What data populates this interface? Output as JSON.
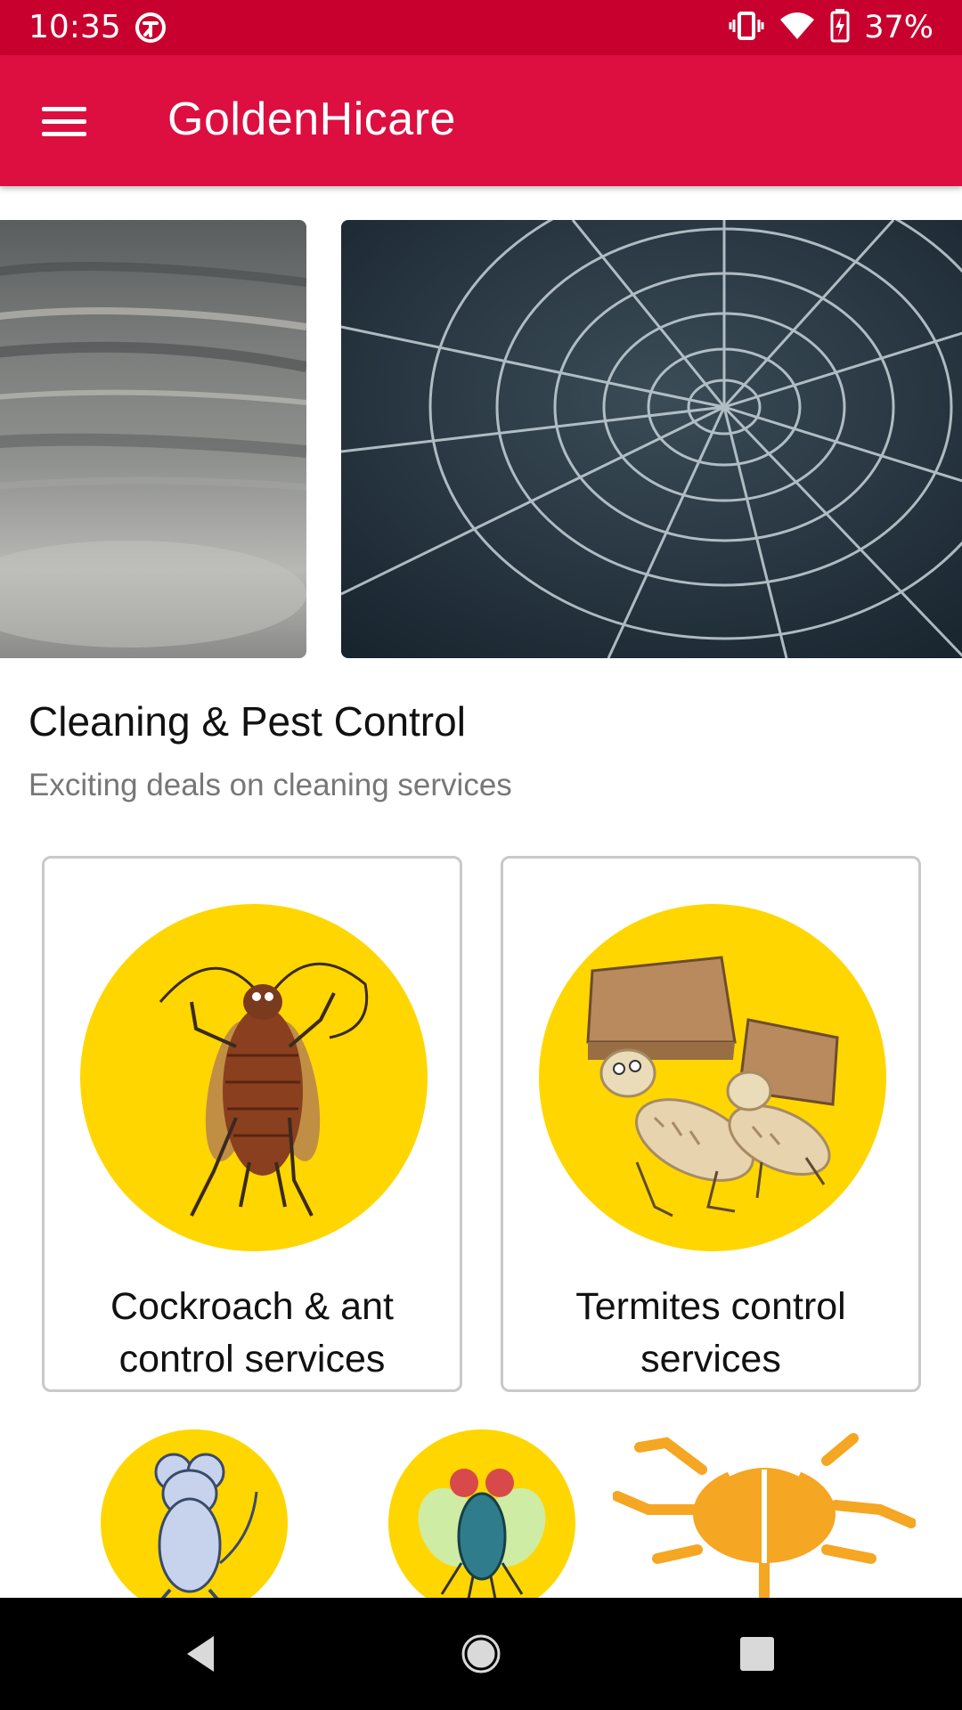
{
  "status_bar": {
    "time": "10:35",
    "battery": "37%",
    "icons": [
      "accessibility-icon",
      "vibrate-icon",
      "wifi-icon",
      "battery-charging-icon"
    ]
  },
  "app_bar": {
    "title": "GoldenHicare",
    "menu_icon": "menu-icon",
    "background": "#dc0f40"
  },
  "carousel": {
    "banners": [
      {
        "name": "wood-texture-banner"
      },
      {
        "name": "spider-web-banner"
      }
    ]
  },
  "section": {
    "title": "Cleaning & Pest Control",
    "subtitle": "Exciting deals on cleaning services"
  },
  "services": [
    {
      "label": "Cockroach & ant control services",
      "icon": "cockroach-icon"
    },
    {
      "label": "Termites control services",
      "icon": "termite-icon"
    }
  ],
  "more_services": [
    {
      "icon": "mouse-icon"
    },
    {
      "icon": "fly-icon"
    },
    {
      "icon": "bug-icon"
    }
  ],
  "nav_bar": {
    "icons": [
      "back-icon",
      "home-icon",
      "recent-apps-icon"
    ]
  },
  "colors": {
    "status_bar": "#c8002e",
    "accent_yellow": "#ffd600",
    "bug_orange": "#f5a623"
  }
}
